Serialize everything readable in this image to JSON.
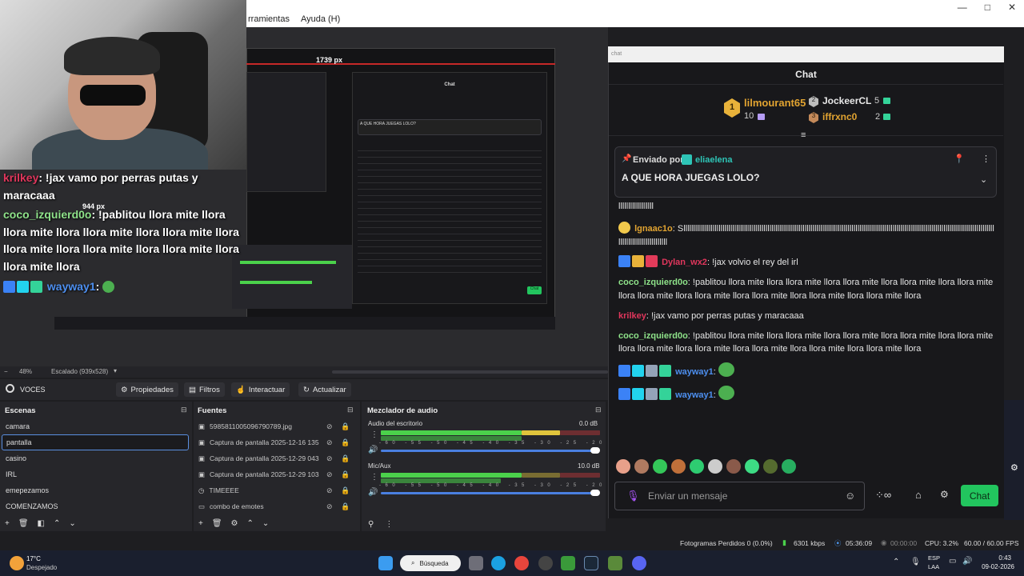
{
  "menu": {
    "items": [
      "rramientas",
      "Ayuda (H)"
    ]
  },
  "window_controls": {
    "minimize": "—",
    "maximize": "□",
    "close": "✕"
  },
  "preview": {
    "px_width_label": "1739 px",
    "px_height_label": "944 px",
    "zoom_label": "48%",
    "scaled_label": "Escalado (939x528)"
  },
  "overlay_chat": {
    "line1_user": "krilkey",
    "line1_text": ": !jax vamo por perras putas y maracaaa",
    "line2_user": "coco_izquierd0o",
    "line2_text": ": !pablitou llora mite llora llora mite llora llora mite llora llora mite llora llora mite llora llora mite llora llora mite llora llora mite llora",
    "line3_user": "wayway1",
    "line3_text": ":"
  },
  "toolbar": {
    "source_name": "VOCES",
    "properties": "Propiedades",
    "filters": "Filtros",
    "interact": "Interactuar",
    "refresh": "Actualizar"
  },
  "scenes": {
    "title": "Escenas",
    "items": [
      "camara",
      "pantalla",
      "casino",
      "IRL",
      "emepezamos",
      "COMENZAMOS"
    ],
    "selected_index": 1
  },
  "sources": {
    "title": "Fuentes",
    "items": [
      "5985811005096790789.jpg",
      "Captura de pantalla 2025-12-16 135",
      "Captura de pantalla 2025-12-29 043",
      "Captura de pantalla 2025-12-29 103",
      "TIMEEEE",
      "combo de emotes"
    ]
  },
  "mixer": {
    "title": "Mezclador de audio",
    "channels": [
      {
        "name": "Audio del escritorio",
        "db": "0.0 dB",
        "level": 0.58
      },
      {
        "name": "Mic/Aux",
        "db": "10.0 dB",
        "level": 0.82
      }
    ],
    "scale": "-60 -55 -50 -45 -40 -35 -30 -25 -20 -15 -10 -5 0"
  },
  "chat": {
    "window_title": "chat",
    "header": "Chat",
    "leaders": [
      {
        "rank": "1",
        "name": "lilmourant65",
        "count": "10"
      },
      {
        "rank": "2",
        "name": "JockeerCL",
        "count": "5"
      },
      {
        "rank": "3",
        "name": "iffrxnc0",
        "count": "2"
      }
    ],
    "pinned": {
      "sent_by": "Enviado por",
      "user": "eliaelena",
      "message": "A QUE HORA JUEGAS LOLO?"
    },
    "messages": [
      {
        "user": "",
        "text": "llllllllllllllllll"
      },
      {
        "user": "lgnaac1o",
        "text": "Sllllllllllllllllllllllllllllllllllllllllllllllllllllllllllllllllllllllllllllllllllllllllllllllllllllllllllllllllllllllllllllllllllllllllllllllllllllllllllllllllllllllllllllllllllllllll"
      },
      {
        "user": "Dylan_wx2",
        "text": "!jax volvio el rey del irl"
      },
      {
        "user": "coco_izquierd0o",
        "text": "!pablitou llora mite llora llora mite llora llora mite llora llora mite llora llora mite llora llora mite llora llora mite llora llora mite llora llora mite llora llora mite llora"
      },
      {
        "user": "krilkey",
        "text": "!jax vamo por perras putas y maracaaa"
      },
      {
        "user": "coco_izquierd0o",
        "text": "!pablitou llora mite llora llora mite llora llora mite llora llora mite llora llora mite llora llora mite llora llora mite llora llora mite llora llora mite llora llora mite llora"
      },
      {
        "user": "wayway1",
        "text": ""
      },
      {
        "user": "wayway1",
        "text": ""
      }
    ],
    "input_placeholder": "Enviar un mensaje",
    "chat_button": "Chat"
  },
  "status": {
    "frames_lost": "Fotogramas Perdidos 0 (0.0%)",
    "bitrate": "6301 kbps",
    "stream_time": "05:36:09",
    "rec_time": "00:00:00",
    "cpu": "CPU: 3.2%",
    "fps": "60.00 / 60.00 FPS"
  },
  "taskbar": {
    "weather_temp": "17°C",
    "weather_desc": "Despejado",
    "search": "Búsqueda",
    "lang": "ESP",
    "lang2": "LAA",
    "time": "0:43",
    "date": "09-02-2026"
  }
}
